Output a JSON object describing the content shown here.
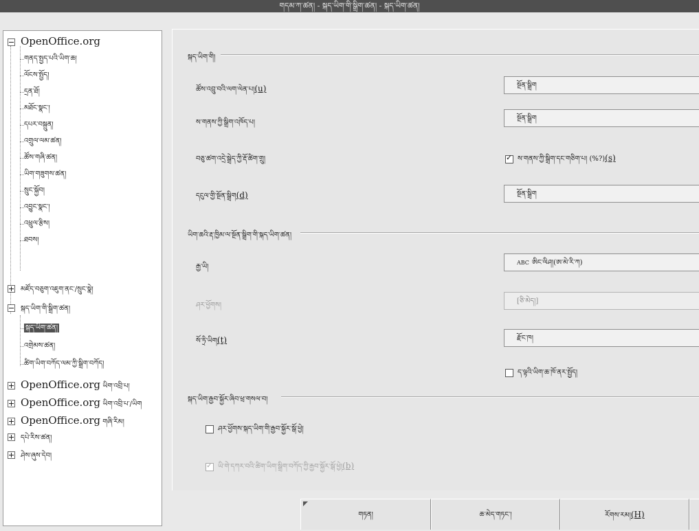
{
  "window": {
    "title": "གདམ་ཀ་ཚན། - སྐད་ཡིག་གི་སྒྲིག་ཚན། - སྐད་ཡིག་ཚན།"
  },
  "tree": {
    "openoffice": {
      "label": "OpenOffice.org",
      "children": [
        "གནད་སྤྱད་པའི་ཡིག་ཆ།",
        "ལོངས་སྤྱོད།",
        "དྲན་ཐོ།",
        "མཐོང་སྣང་།",
        "དཔར་བསྐྲུན།",
        "འགྲུལ་ལམ་ཚན།",
        "ཚོས་གཞི་ཚན།",
        "ཡིག་གཟུགས་ཚན།",
        "སྲུང་སྐྱོབ།",
        "འབྱུང་སྣང་།",
        "འཕྲུལ་རྩིས།",
        "ཐབས།"
      ]
    },
    "load_save": {
      "label": "མཛོད་བཅུག་འཇུག་ནང་/སྲུང་སྣེ།"
    },
    "lang_settings": {
      "label": "སྐད་ཡིག་གི་སྒྲིག་ཚན།",
      "children": [
        "སྐད་ཡིག་ཚན།",
        "འགྲེམས་ཚན།",
        "ཚིག་ཡིག་བཀོད་ལམ་ཀྱི་སྒྲིག་བཀོད།"
      ]
    },
    "others": [
      {
        "prefix": "OpenOffice.org",
        "suffix": "ཡིག་འབྲི་པ།"
      },
      {
        "prefix": "OpenOffice.org",
        "suffix": "ཡིག་འབྲི་པ་/ཡིག"
      },
      {
        "prefix": "OpenOffice.org",
        "suffix": "གཞི་རིམ།"
      },
      {
        "prefix": "",
        "suffix": "དཔེ་རིས་ཚན།"
      },
      {
        "prefix": "",
        "suffix": "ཤེས་ཞུས་དེབ།"
      }
    ]
  },
  "panel": {
    "section_lang": "སྐད་ཡིག་གི།",
    "ui_label": "ཚོས་འབྲུ་བའི་ལག་ལེན་པ།",
    "ui_accel": "(u)",
    "ui_value": "སྔོན་སྒྲིག",
    "locale_label": "ས་གནས་ཀྱི་སྒྲིག་འཁོད་པ།",
    "locale_value": "སྔོན་སྒྲིག",
    "decimal_label": "བཅུ་ཚག་འདྲེ་སྒྲེད་ཀྱི་རྡོ་ཚིག་གྲུ།",
    "decimal_check": "ས་གནས་ཀྱི་སྒྲིག་དང་གཅིག་པ། (",
    "decimal_symbol": "%?",
    "decimal_tail": ")",
    "decimal_accel": "(s)",
    "currency_label": "དངུལ་གྱི་སྔོན་སྒྲིག",
    "currency_accel": "(d)",
    "currency_value": "སྔོན་སྒྲིག",
    "section_doc": "ཡིག་ཆའི་རྡ་ཁྱིམ་ལ་སྔོན་སྒྲིག་གི་སྐད་ཡིག་ཚན།",
    "western_label": "རྒྱ་ཡི།",
    "western_value": "ཨིང་ལིཤ།(ཨ་མེ་རི་ཀ)",
    "western_abc": "ABC",
    "asian_label": "ཤར་ཕྱོགས།",
    "asian_value": "[ཅི་མེད།]",
    "ctl_label": "སོ་ཏྲི་ཡིག",
    "ctl_accel": "(t)",
    "ctl_value": "རྫོང་ཁ།",
    "current_doc_check": "ད་ལྟའི་ཡིག་ཆ་ཁོ་ནར་སྤྱོད།",
    "section_support": "སྐད་ཡིག་རྒྱབ་སྐྱོར་ཞིབ་ཕྲ་གསལ་བ།",
    "asian_support": "ཤར་ཕྱོགས་སྐད་ཡིག་གི་རྒྱབ་སྐྱོར་སྒོ་ཕྱེ།",
    "ctl_support": "ཡི་གེ་དཀར་བའི་ཚིག་ཡིག་སྒྲིག་བཀོད་ཀྱི་རྒྱབ་སྐྱོར་སྒོ་ཕྱེ།",
    "ctl_support_accel": "(b)"
  },
  "buttons": {
    "ok": "གཏན།",
    "cancel": "ཆ་མེད་གཏང་།",
    "help": "རོགས་རམ།",
    "help_accel": "(H)"
  }
}
